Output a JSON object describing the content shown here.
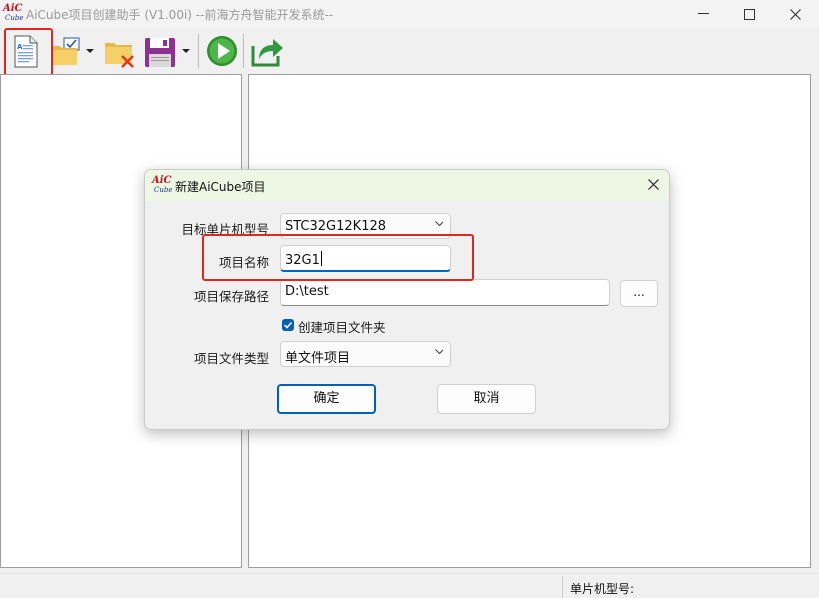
{
  "window": {
    "logo_top": "AiC",
    "logo_bottom": "Cube",
    "title": "AiCube项目创建助手 (V1.00i) --前海方舟智能开发系统--",
    "minimize_glyph": "—",
    "maximize_glyph": "☐",
    "close_glyph": "✕"
  },
  "toolbar": {
    "icons": [
      "new-project-icon",
      "open-project-icon",
      "close-project-icon",
      "save-project-icon",
      "run-icon",
      "export-icon"
    ]
  },
  "statusbar": {
    "mcu_label": "单片机型号:"
  },
  "dialog": {
    "title": "新建AiCube项目",
    "close_glyph": "✕",
    "mcu_label": "目标单片机型号",
    "mcu_value": "STC32G12K128",
    "name_label": "项目名称",
    "name_value": "32G1",
    "path_label": "项目保存路径",
    "path_value": "D:\\test",
    "browse_label": "...",
    "create_folder_label": "创建项目文件夹",
    "create_folder_checked": true,
    "type_label": "项目文件类型",
    "type_value": "单文件项目",
    "ok_label": "确定",
    "cancel_label": "取消"
  },
  "colors": {
    "highlight": "#e0271e",
    "accent": "#005fb8",
    "dialog_title_bg": "#eef6e4"
  }
}
